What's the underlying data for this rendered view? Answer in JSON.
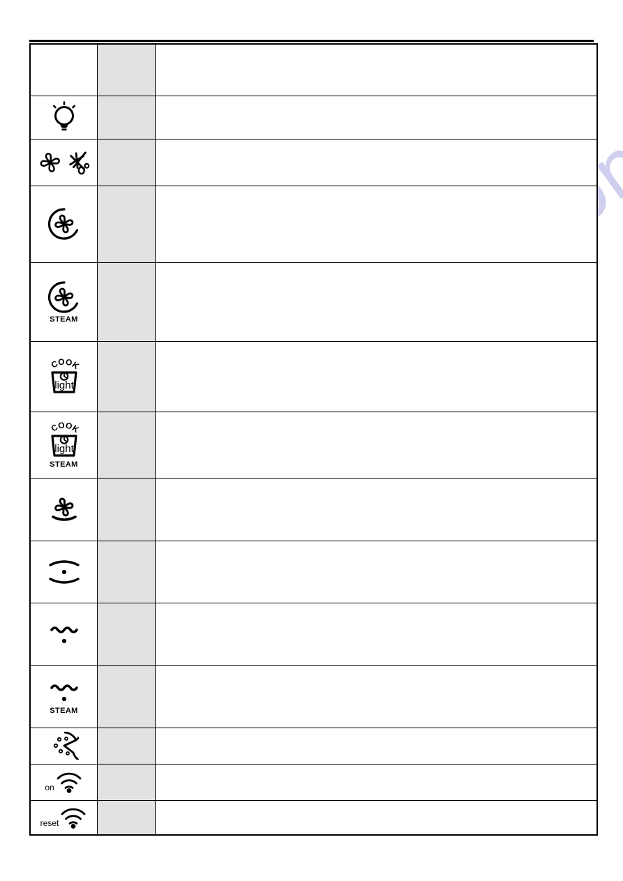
{
  "page": {
    "background_color": "#ffffff",
    "rule_color": "#000000",
    "shaded_column_color": "#e2e2e2",
    "border_color": "#000000"
  },
  "watermark": {
    "text": "manualshive.com",
    "color": "#cdcdef"
  },
  "table": {
    "name": "oven-function-symbol-table",
    "columns": [
      {
        "key": "symbol",
        "header": ""
      },
      {
        "key": "shaded",
        "header": ""
      },
      {
        "key": "description",
        "header": ""
      }
    ],
    "rows": [
      {
        "icon_name": "blank-symbol",
        "symbol_label": "",
        "sublabel": "",
        "shaded": "",
        "description": ""
      },
      {
        "icon_name": "oven-light-bulb-icon",
        "symbol_label": "",
        "sublabel": "",
        "shaded": "",
        "description": ""
      },
      {
        "icon_name": "fan-and-defrost-icon",
        "symbol_label": "",
        "sublabel": "",
        "shaded": "",
        "description": ""
      },
      {
        "icon_name": "fan-circle-icon",
        "symbol_label": "",
        "sublabel": "",
        "shaded": "",
        "description": ""
      },
      {
        "icon_name": "fan-circle-steam-icon",
        "symbol_label": "STEAM",
        "sublabel": "",
        "shaded": "",
        "description": ""
      },
      {
        "icon_name": "cook-light-icon",
        "symbol_label": "",
        "sublabel": "",
        "shaded": "",
        "description": ""
      },
      {
        "icon_name": "cook-light-steam-icon",
        "symbol_label": "STEAM",
        "sublabel": "",
        "shaded": "",
        "description": ""
      },
      {
        "icon_name": "fan-bottom-heat-icon",
        "symbol_label": "",
        "sublabel": "",
        "shaded": "",
        "description": ""
      },
      {
        "icon_name": "top-bottom-heat-icon",
        "symbol_label": "",
        "sublabel": "",
        "shaded": "",
        "description": ""
      },
      {
        "icon_name": "grill-wave-icon",
        "symbol_label": "",
        "sublabel": "",
        "shaded": "",
        "description": ""
      },
      {
        "icon_name": "grill-wave-steam-icon",
        "symbol_label": "STEAM",
        "sublabel": "",
        "shaded": "",
        "description": ""
      },
      {
        "icon_name": "pizza-icon",
        "symbol_label": "",
        "sublabel": "",
        "shaded": "",
        "description": ""
      },
      {
        "icon_name": "wifi-on-icon",
        "symbol_label": "on",
        "sublabel": "",
        "shaded": "",
        "description": ""
      },
      {
        "icon_name": "wifi-reset-icon",
        "symbol_label": "reset",
        "sublabel": "",
        "shaded": "",
        "description": ""
      }
    ],
    "icon_glyph_labels": {
      "cook_top_text": "COOK",
      "cook_inner_text": "light",
      "steam_text": "STEAM",
      "wifi_on_text": "on",
      "wifi_reset_text": "reset"
    }
  }
}
